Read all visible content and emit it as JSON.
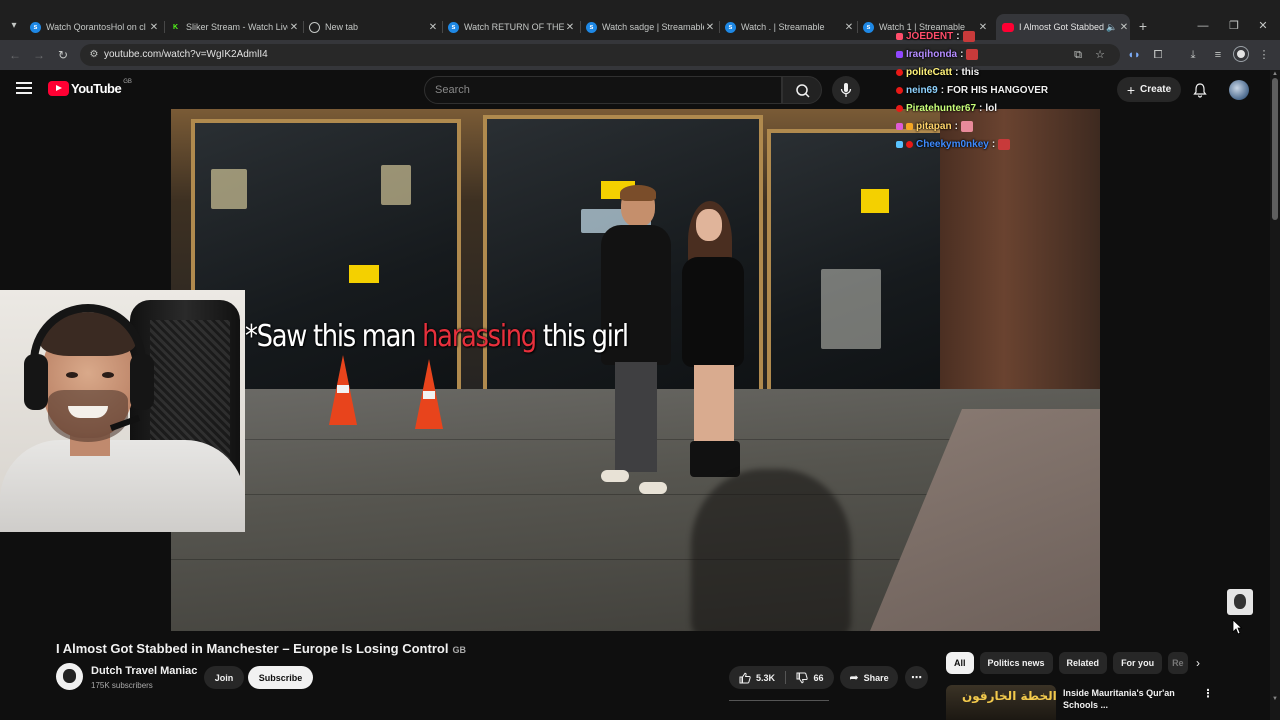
{
  "browser": {
    "tabs": [
      {
        "title": "Watch QorantosHol on cl",
        "icon": "streamable-icon",
        "active": false
      },
      {
        "title": "Sliker Stream - Watch Live",
        "icon": "kick-icon",
        "active": false
      },
      {
        "title": "New tab",
        "icon": "chrome-icon",
        "active": false
      },
      {
        "title": "Watch RETURN OF THE G",
        "icon": "streamable-icon",
        "active": false
      },
      {
        "title": "Watch sadge | Streamable",
        "icon": "streamable-icon",
        "active": false
      },
      {
        "title": "Watch . | Streamable",
        "icon": "streamable-icon",
        "active": false
      },
      {
        "title": "Watch 1 | Streamable",
        "icon": "streamable-icon",
        "active": false
      },
      {
        "title": "I Almost Got Stabbed",
        "icon": "youtube-icon",
        "active": true
      }
    ],
    "url": "youtube.com/watch?v=WgIK2AdmlI4"
  },
  "youtube": {
    "logo_text": "YouTube",
    "region": "GB",
    "search_placeholder": "Search",
    "create_label": "Create"
  },
  "video": {
    "caption_before": "*Saw this man ",
    "caption_highlight": "harassing",
    "caption_after": " this girl",
    "title": "I Almost Got Stabbed in Manchester – Europe Is Losing Control",
    "title_flag": "GB",
    "channel_name": "Dutch Travel Maniac",
    "subscribers": "175K subscribers",
    "join_label": "Join",
    "subscribe_label": "Subscribe",
    "likes": "5.3K",
    "dislikes": "66",
    "share_label": "Share"
  },
  "chat": [
    {
      "user": "JOEDENT",
      "color": "#ff4d6a",
      "message": "",
      "emote": true
    },
    {
      "user": "Iraqihonda",
      "color": "#b48cff",
      "message": "",
      "emote": true
    },
    {
      "user": "politeCatt",
      "color": "#fff27a",
      "message": "this",
      "emote": false
    },
    {
      "user": "nein69",
      "color": "#8fd3ff",
      "message": "FOR HIS HANGOVER",
      "emote": false
    },
    {
      "user": "Piratehunter67",
      "color": "#c8ff7a",
      "message": "lol",
      "emote": false
    },
    {
      "user": "pitapan",
      "color": "#ffd36a",
      "message": "",
      "emote": true
    },
    {
      "user": "Cheekym0nkey",
      "color": "#3e8bff",
      "message": "",
      "emote": true
    }
  ],
  "chips": [
    "All",
    "Politics news",
    "Related",
    "For you",
    "Re"
  ],
  "recommendation": {
    "thumb_text": "الخطة الخارقون!",
    "title": "Inside Mauritania's Qur'an Schools ..."
  },
  "colors": {
    "youtube_red": "#ff0033",
    "caption_highlight": "#e7303c",
    "background": "#0f0f0f"
  }
}
